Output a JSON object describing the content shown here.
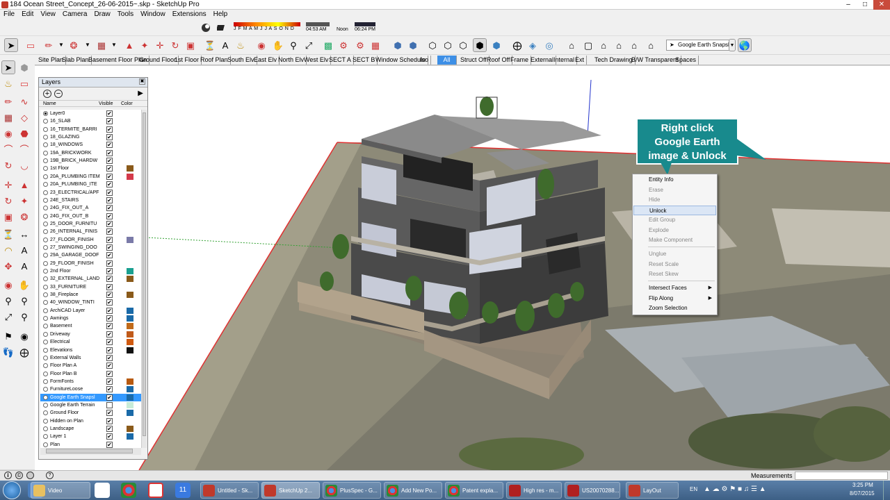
{
  "window": {
    "title": "184 Ocean Street_Concept_26-06-2015~.skp - SketchUp Pro"
  },
  "menu": [
    "File",
    "Edit",
    "View",
    "Camera",
    "Draw",
    "Tools",
    "Window",
    "Extensions",
    "Help"
  ],
  "shadow": {
    "months": "J F M A M J J A S O N D",
    "time_start": "04:53 AM",
    "noon": "Noon",
    "time_end": "06:24 PM"
  },
  "google_earth_tool": {
    "label": "Google Earth Snapsl"
  },
  "scenes": [
    "Site Plan",
    "Slab Plan",
    "Basement Floor Plan",
    "Ground Floor",
    "1st Floor",
    "Roof Plan",
    "South Elv",
    "East Elv",
    "North Elv",
    "West Elv",
    "SECT A",
    "SECT B",
    "Window Schedule",
    "Iso",
    "All",
    "Struct Off",
    "Roof Off",
    "Frame",
    "External",
    "Internal",
    "Ext",
    "Tech Drawing",
    "B/W Transparent",
    "Spaces"
  ],
  "active_scene": "All",
  "layers_panel": {
    "title": "Layers",
    "columns": {
      "name": "Name",
      "visible": "Visible",
      "color": "Color"
    },
    "rows": [
      {
        "name": "Layer0",
        "active": true,
        "visible": true,
        "color": ""
      },
      {
        "name": "16_SLAB",
        "visible": true,
        "color": ""
      },
      {
        "name": "16_TERMITE_BARRI",
        "visible": true,
        "color": ""
      },
      {
        "name": "18_GLAZING",
        "visible": true,
        "color": ""
      },
      {
        "name": "18_WINDOWS",
        "visible": true,
        "color": ""
      },
      {
        "name": "19A_BRICKWORK",
        "visible": true,
        "color": ""
      },
      {
        "name": "19B_BRICK_HARDW",
        "visible": true,
        "color": ""
      },
      {
        "name": "1st Floor",
        "visible": true,
        "color": "#8a5a1a"
      },
      {
        "name": "20A_PLUMBING ITEM",
        "visible": true,
        "color": "#d43a4a"
      },
      {
        "name": "20A_PLUMBING_ITE",
        "visible": true,
        "color": ""
      },
      {
        "name": "23_ELECTRICAL/APF",
        "visible": true,
        "color": ""
      },
      {
        "name": "24E_STAIRS",
        "visible": true,
        "color": ""
      },
      {
        "name": "24G_FIX_OUT_A",
        "visible": true,
        "color": ""
      },
      {
        "name": "24G_FIX_OUT_B",
        "visible": true,
        "color": ""
      },
      {
        "name": "25_DOOR_FURNITU",
        "visible": true,
        "color": ""
      },
      {
        "name": "26_INTERNAL_FINIS",
        "visible": true,
        "color": ""
      },
      {
        "name": "27_FLOOR_FINISH",
        "visible": true,
        "color": "#7a7aa8"
      },
      {
        "name": "27_SWINGING_DOO",
        "visible": true,
        "color": ""
      },
      {
        "name": "29A_GARAGE_DOOF",
        "visible": true,
        "color": ""
      },
      {
        "name": "29_FLOOR_FINISH",
        "visible": true,
        "color": ""
      },
      {
        "name": "2nd Floor",
        "visible": true,
        "color": "#1aa090"
      },
      {
        "name": "32_EXTERNAL_LAND",
        "visible": true,
        "color": "#8a5a1a"
      },
      {
        "name": "33_FURNITURE",
        "visible": true,
        "color": ""
      },
      {
        "name": "38_Fireplace",
        "visible": true,
        "color": "#8a5a1a"
      },
      {
        "name": "40_WINDOW_TINTI",
        "visible": true,
        "color": ""
      },
      {
        "name": "ArchiCAD Layer",
        "visible": true,
        "color": "#1a6aa8"
      },
      {
        "name": "Awnings",
        "visible": true,
        "color": "#1a6aa8"
      },
      {
        "name": "Basement",
        "visible": true,
        "color": "#c06a1a"
      },
      {
        "name": "Driveway",
        "visible": true,
        "color": "#c05a1a"
      },
      {
        "name": "Electrical",
        "visible": true,
        "color": "#d05a10"
      },
      {
        "name": "Elevations",
        "visible": true,
        "color": "#111111"
      },
      {
        "name": "External Walls",
        "visible": true,
        "color": ""
      },
      {
        "name": "Floor Plan A",
        "visible": true,
        "color": ""
      },
      {
        "name": "Floor Plan B",
        "visible": true,
        "color": ""
      },
      {
        "name": "FormFonts",
        "visible": true,
        "color": "#b85a10"
      },
      {
        "name": "FurnitureLoose",
        "visible": true,
        "color": "#1a6aa8"
      },
      {
        "name": "Google Earth Snapsl",
        "visible": true,
        "selected": true,
        "color": "#1a6aa8"
      },
      {
        "name": "Google Earth Terrain",
        "visible": false,
        "color": "#c8ecd8"
      },
      {
        "name": "Ground Floor",
        "visible": true,
        "color": "#1a6aa8"
      },
      {
        "name": "Hidden on Plan",
        "visible": true,
        "color": ""
      },
      {
        "name": "Landscape",
        "visible": true,
        "color": "#8a5a1a"
      },
      {
        "name": "Layer 1",
        "visible": true,
        "color": "#1a6aa8"
      },
      {
        "name": "Plan",
        "visible": true,
        "color": ""
      }
    ]
  },
  "context_menu": {
    "items": [
      {
        "label": "Entity Info",
        "enabled": true
      },
      {
        "label": "Erase",
        "enabled": false
      },
      {
        "label": "Hide",
        "enabled": false
      },
      {
        "label": "Unlock",
        "enabled": true,
        "highlighted": true
      },
      {
        "label": "Edit Group",
        "enabled": false
      },
      {
        "label": "Explode",
        "enabled": false
      },
      {
        "label": "Make Component",
        "enabled": false
      },
      {
        "label": "Unglue",
        "enabled": false
      },
      {
        "label": "Reset Scale",
        "enabled": false
      },
      {
        "label": "Reset Skew",
        "enabled": false
      },
      {
        "label": "Intersect Faces",
        "enabled": true,
        "submenu": true
      },
      {
        "label": "Flip Along",
        "enabled": true,
        "submenu": true
      },
      {
        "label": "Zoom Selection",
        "enabled": true
      }
    ]
  },
  "callout": {
    "lines": [
      "Right click",
      "Google Earth",
      "image & Unlock"
    ]
  },
  "status": {
    "measurements_label": "Measurements"
  },
  "taskbar": {
    "items": [
      {
        "label": "Video",
        "color": "#e8c060"
      },
      {
        "label": "Untitled - Sk...",
        "color": "#c0392b"
      },
      {
        "label": "SketchUp 2...",
        "color": "#c0392b"
      },
      {
        "label": "PlusSpec - G...",
        "color": "#e8b020"
      },
      {
        "label": "Add New Po...",
        "color": "#e8b020"
      },
      {
        "label": "Patent expla...",
        "color": "#e8b020"
      },
      {
        "label": "High res - m...",
        "color": "#b02020"
      },
      {
        "label": "US20070288...",
        "color": "#b02020"
      },
      {
        "label": "LayOut",
        "color": "#c0392b"
      }
    ],
    "lang": "EN",
    "time": "3:25 PM",
    "date": "8/07/2015"
  }
}
